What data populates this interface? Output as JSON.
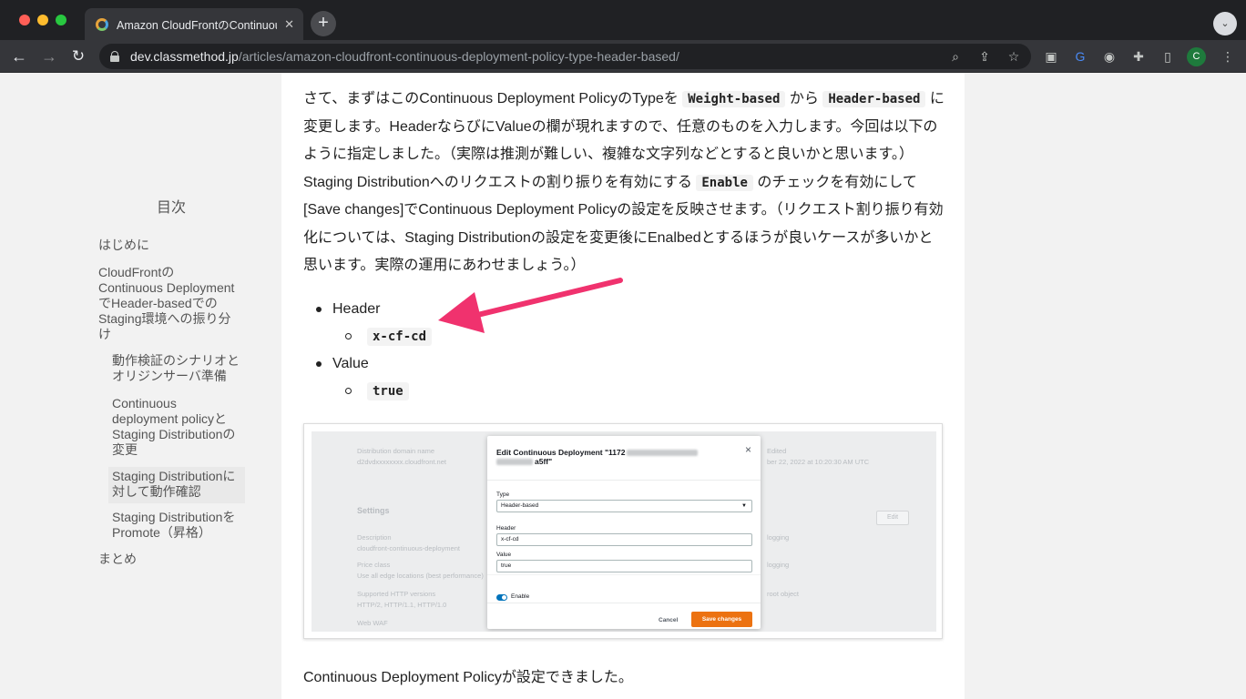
{
  "browser": {
    "tab_title": "Amazon CloudFrontのContinuous",
    "tab_close": "✕",
    "new_tab": "+",
    "tab_menu": "⌄",
    "url_host": "dev.classmethod.jp",
    "url_path": "/articles/amazon-cloudfront-continuous-deployment-policy-type-header-based/",
    "profile_initial": "C",
    "icons": [
      "back-arrow-icon",
      "forward-arrow-icon",
      "reload-icon",
      "lock-icon",
      "zoom-icon",
      "share-icon",
      "bookmark-star-icon",
      "extension-icon",
      "translate-icon",
      "password-icon",
      "puzzle-icon",
      "sidebar-icon",
      "kebab-menu-icon"
    ]
  },
  "toc": {
    "title": "目次",
    "items": [
      "はじめに",
      "CloudFrontのContinuous DeploymentでHeader-basedでのStaging環境への振り分け",
      "動作検証のシナリオとオリジンサーバ準備",
      "Continuous deployment policyとStaging Distributionの変更",
      "Staging Distributionに対して動作確認",
      "Staging DistributionをPromote（昇格）",
      "まとめ"
    ]
  },
  "article": {
    "p1": "さて、まずはこのContinuous Deployment PolicyのTypeを",
    "code1": "Weight-based",
    "p2": "から",
    "code2": "Header-based",
    "p3": "に変更します。HeaderならびにValueの欄が現れますので、任意のものを入力します。今回は以下のように指定しました。（実際は推測が難しい、複雑な文字列などとすると良いかと思います。）Staging Distributionへのリクエストの割り振りを有効にする",
    "code3": "Enable",
    "p4": "のチェックを有効にして[Save changes]でContinuous Deployment Policyの設定を反映させます。（リクエスト割り振り有効化については、Staging Distributionの設定を変更後にEnalbedとするほうが良いケースが多いかと思います。実際の運用にあわせましょう。）",
    "list": [
      {
        "label": "Header",
        "value": "x-cf-cd"
      },
      {
        "label": "Value",
        "value": "true"
      }
    ],
    "after_text": "Continuous Deployment Policyが設定できました。",
    "arrow_color": "#f0326e"
  },
  "figure": {
    "background_texts": [
      "Distribution domain name",
      "d2dvdxxxxxxxx.cloudfront.net",
      "Settings",
      "Description",
      "cloudfront-continuous-deployment",
      "Price class",
      "Use all edge locations (best performance)",
      "Supported HTTP versions",
      "HTTP/2, HTTP/1.1, HTTP/1.0",
      "Web WAF",
      "Edited",
      "ber 22, 2022 at 10:20:30 AM UTC",
      "logging",
      "logging",
      "root object"
    ],
    "background_button": "Edit",
    "modal": {
      "title_prefix": "Edit Continuous Deployment \"1172",
      "title_suffix": "a5ff\"",
      "close": "×",
      "type_label": "Type",
      "type_value": "Header-based",
      "select_caret": "▼",
      "header_label": "Header",
      "header_value": "x-cf-cd",
      "value_label": "Value",
      "value_value": "true",
      "enable_label": "Enable",
      "cancel_label": "Cancel",
      "save_label": "Save changes",
      "save_color": "#ec7211"
    }
  }
}
